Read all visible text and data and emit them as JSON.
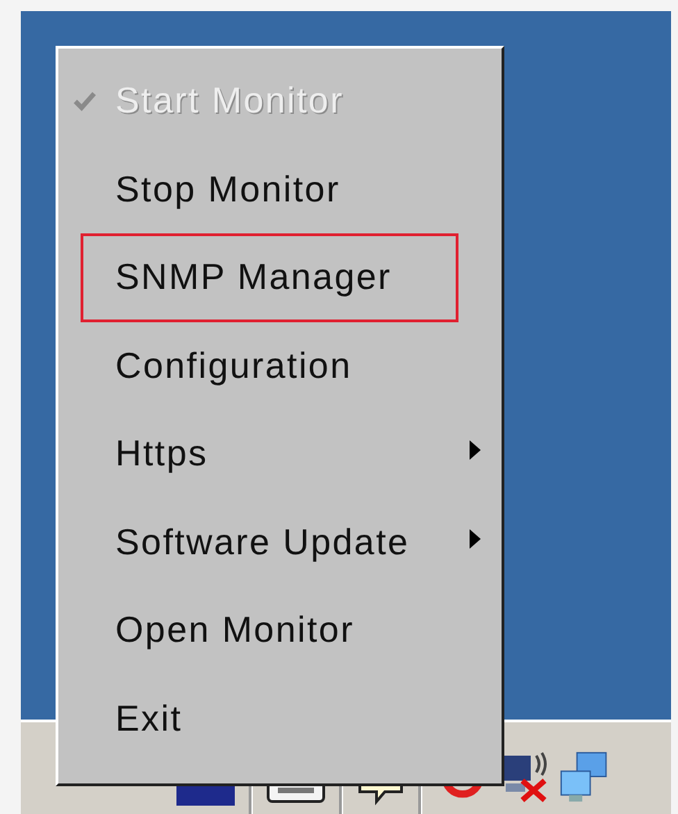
{
  "menu": {
    "items": [
      {
        "label": "Start Monitor",
        "checked": true,
        "disabled": true,
        "highlighted": false,
        "submenu": false
      },
      {
        "label": "Stop Monitor",
        "checked": false,
        "disabled": false,
        "highlighted": false,
        "submenu": false
      },
      {
        "label": "SNMP Manager",
        "checked": false,
        "disabled": false,
        "highlighted": true,
        "submenu": false
      },
      {
        "label": "Configuration",
        "checked": false,
        "disabled": false,
        "highlighted": false,
        "submenu": false
      },
      {
        "label": "Https",
        "checked": false,
        "disabled": false,
        "highlighted": false,
        "submenu": true
      },
      {
        "label": "Software Update",
        "checked": false,
        "disabled": false,
        "highlighted": false,
        "submenu": true
      },
      {
        "label": "Open Monitor",
        "checked": false,
        "disabled": false,
        "highlighted": false,
        "submenu": false
      },
      {
        "label": "Exit",
        "checked": false,
        "disabled": false,
        "highlighted": false,
        "submenu": false
      }
    ]
  }
}
